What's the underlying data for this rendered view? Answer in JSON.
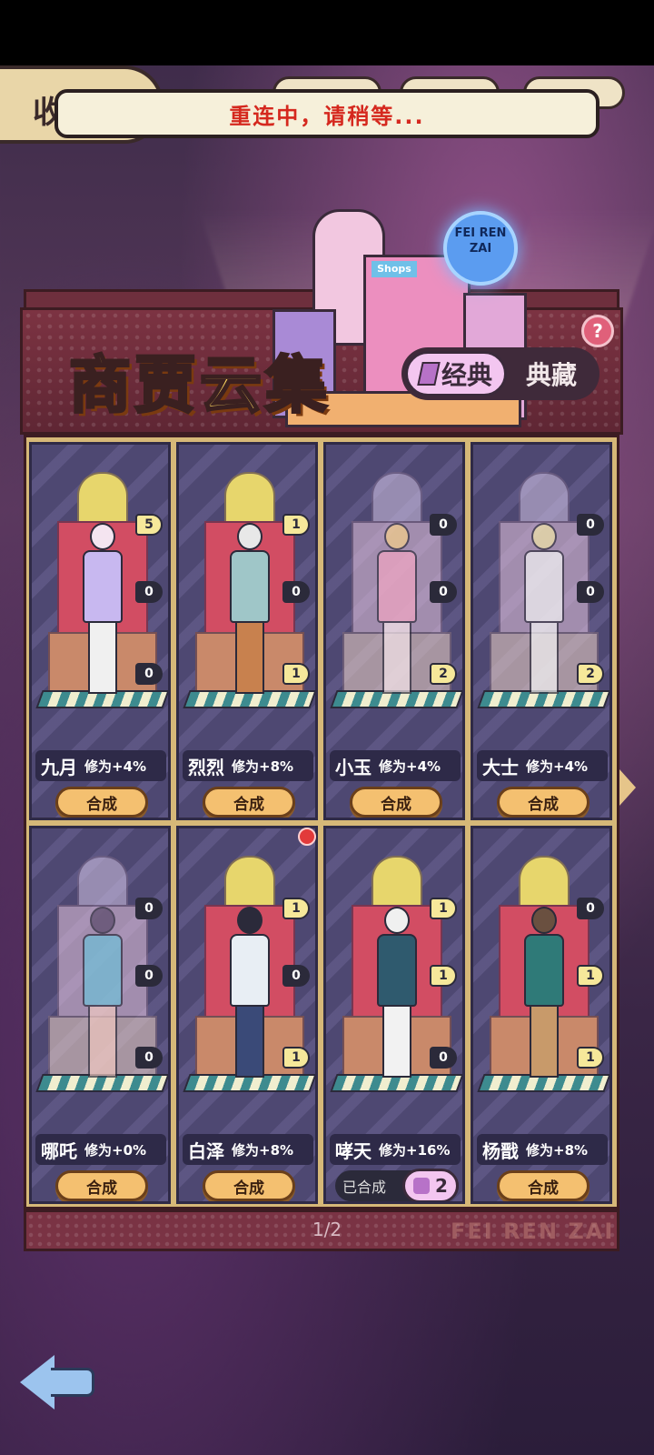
{
  "toast": "重连中，请稍等...",
  "top_tab_label": "收",
  "title": "商贾云集",
  "tabs": {
    "classic": "经典",
    "collection": "典藏"
  },
  "help_symbol": "?",
  "neon_sign": "FEI REN ZAI",
  "shop_sign": "Shops",
  "cards": [
    {
      "name": "九月",
      "bonus": "修为+4%",
      "badges": [
        "5",
        "0",
        "0"
      ],
      "button": "合成"
    },
    {
      "name": "烈烈",
      "bonus": "修为+8%",
      "badges": [
        "1",
        "0",
        "1"
      ],
      "button": "合成"
    },
    {
      "name": "小玉",
      "bonus": "修为+4%",
      "badges": [
        "0",
        "0",
        "2"
      ],
      "button": "合成"
    },
    {
      "name": "大士",
      "bonus": "修为+4%",
      "badges": [
        "0",
        "0",
        "2"
      ],
      "button": "合成"
    },
    {
      "name": "哪吒",
      "bonus": "修为+0%",
      "badges": [
        "0",
        "0",
        "0"
      ],
      "button": "合成"
    },
    {
      "name": "白泽",
      "bonus": "修为+8%",
      "badges": [
        "1",
        "0",
        "1"
      ],
      "button": "合成"
    },
    {
      "name": "哮天",
      "bonus": "修为+16%",
      "badges": [
        "1",
        "1",
        "0"
      ],
      "button": "已合成",
      "puzzle_count": "2"
    },
    {
      "name": "杨戬",
      "bonus": "修为+8%",
      "badges": [
        "0",
        "1",
        "1"
      ],
      "button": "合成"
    }
  ],
  "page_indicator": "1/2",
  "brand": "FEI REN ZAI"
}
